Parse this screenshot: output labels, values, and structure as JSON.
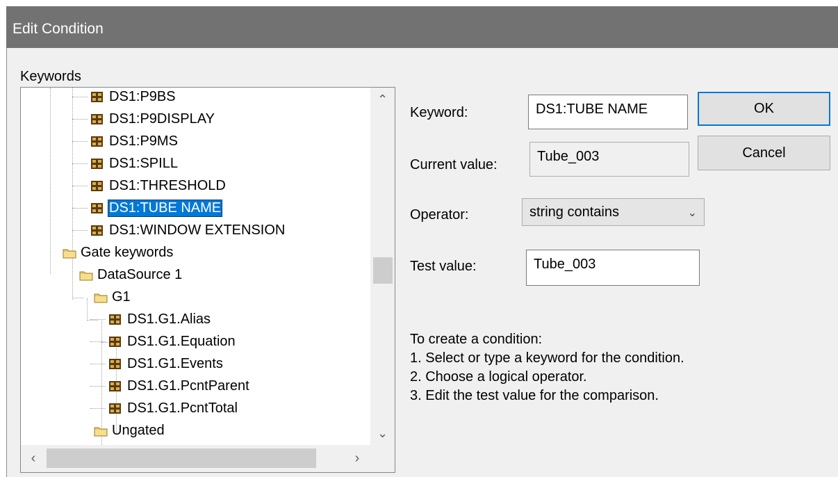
{
  "window": {
    "title": "Edit Condition"
  },
  "keywords_label": "Keywords",
  "tree": {
    "items": [
      {
        "label": "DS1:P9BS",
        "type": "keyword"
      },
      {
        "label": "DS1:P9DISPLAY",
        "type": "keyword"
      },
      {
        "label": "DS1:P9MS",
        "type": "keyword"
      },
      {
        "label": "DS1:SPILL",
        "type": "keyword"
      },
      {
        "label": "DS1:THRESHOLD",
        "type": "keyword"
      },
      {
        "label": "DS1:TUBE NAME",
        "type": "keyword",
        "selected": true
      },
      {
        "label": "DS1:WINDOW EXTENSION",
        "type": "keyword"
      },
      {
        "label": "Gate keywords",
        "type": "folder"
      },
      {
        "label": "DataSource 1",
        "type": "folder"
      },
      {
        "label": "G1",
        "type": "folder"
      },
      {
        "label": "DS1.G1.Alias",
        "type": "keyword"
      },
      {
        "label": "DS1.G1.Equation",
        "type": "keyword"
      },
      {
        "label": "DS1.G1.Events",
        "type": "keyword"
      },
      {
        "label": "DS1.G1.PcntParent",
        "type": "keyword"
      },
      {
        "label": "DS1.G1.PcntTotal",
        "type": "keyword"
      },
      {
        "label": "Ungated",
        "type": "folder"
      }
    ]
  },
  "form": {
    "keyword_label": "Keyword:",
    "keyword_value": "DS1:TUBE NAME",
    "current_value_label": "Current value:",
    "current_value": "Tube_003",
    "operator_label": "Operator:",
    "operator_value": "string contains",
    "test_value_label": "Test value:",
    "test_value": "Tube_003"
  },
  "buttons": {
    "ok": "OK",
    "cancel": "Cancel"
  },
  "instructions": {
    "heading": "To create a condition:",
    "steps": [
      "1. Select or type a keyword for the condition.",
      "2. Choose a logical operator.",
      "3. Edit the test value for the comparison."
    ]
  },
  "colors": {
    "selection": "#0078d7",
    "titlebar": "#727272",
    "dialog_bg": "#f0f0f0"
  }
}
